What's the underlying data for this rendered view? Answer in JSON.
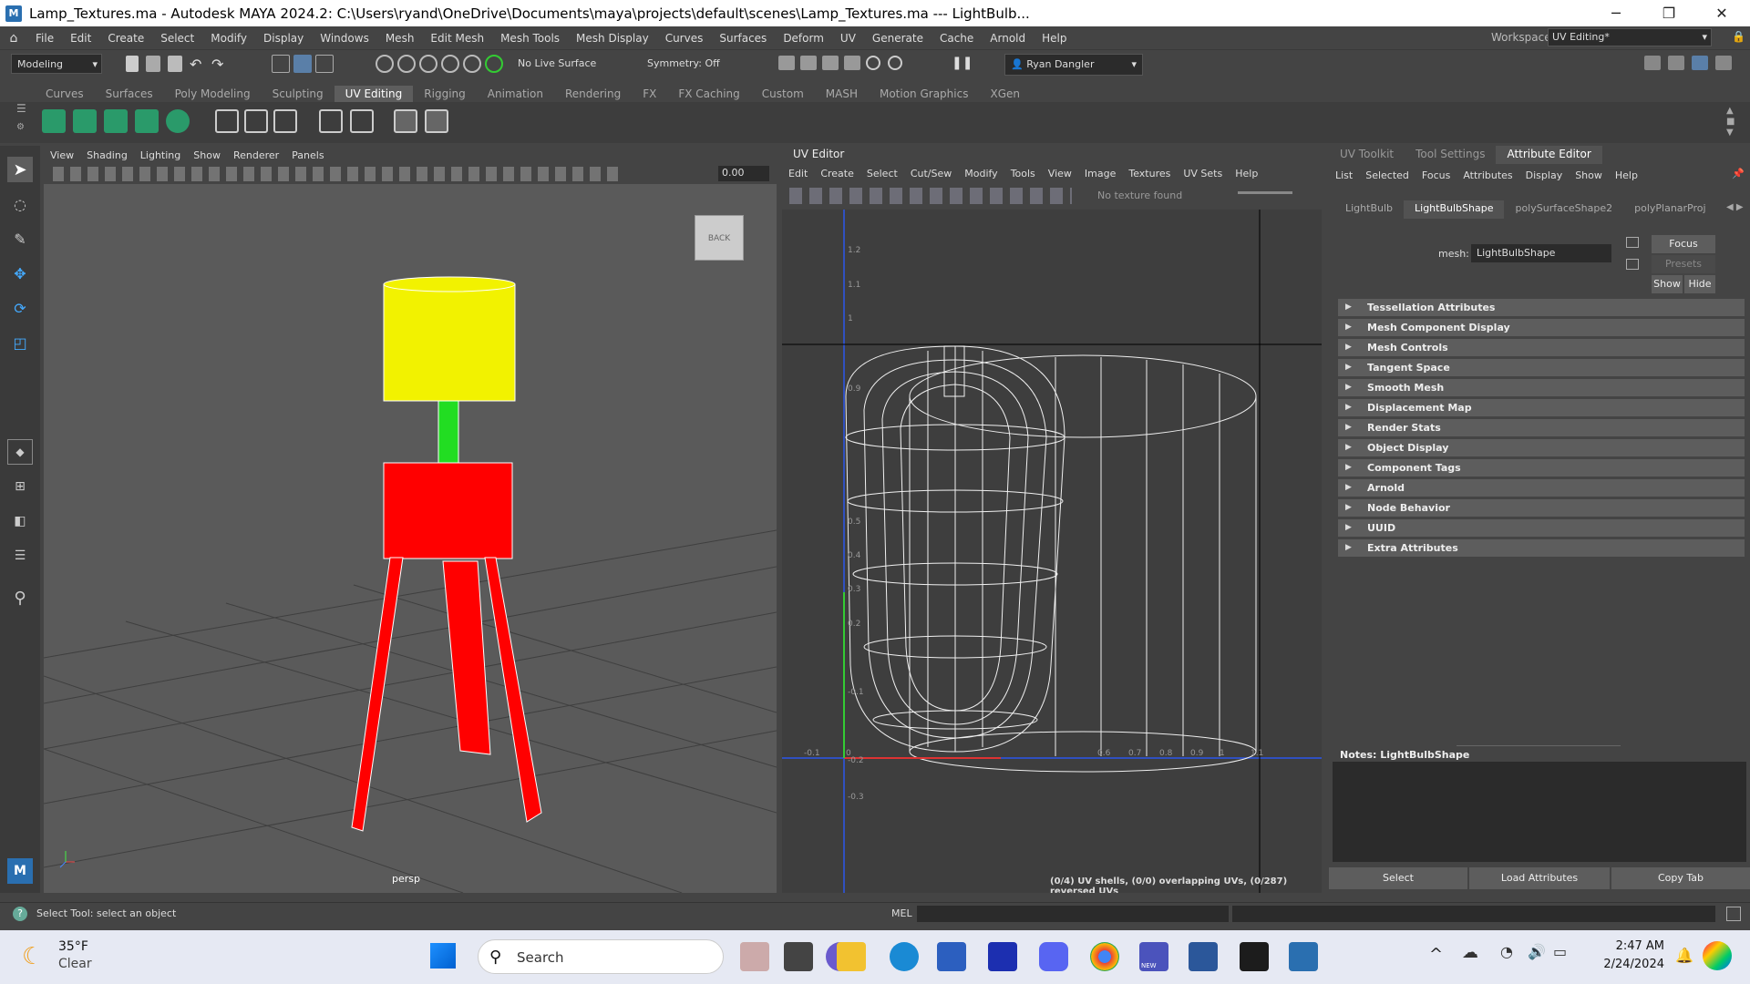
{
  "window": {
    "title": "Lamp_Textures.ma - Autodesk MAYA 2024.2: C:\\Users\\ryand\\OneDrive\\Documents\\maya\\projects\\default\\scenes\\Lamp_Textures.ma   ---   LightBulb...",
    "minimize": "─",
    "restore": "❐",
    "close": "✕"
  },
  "menu": {
    "items": [
      "File",
      "Edit",
      "Create",
      "Select",
      "Modify",
      "Display",
      "Windows",
      "Mesh",
      "Edit Mesh",
      "Mesh Tools",
      "Mesh Display",
      "Curves",
      "Surfaces",
      "Deform",
      "UV",
      "Generate",
      "Cache",
      "Arnold",
      "Help"
    ],
    "workspace_label": "Workspace:",
    "workspace_value": "UV Editing*"
  },
  "statusline": {
    "mode": "Modeling",
    "live_surface": "No Live Surface",
    "symmetry": "Symmetry: Off",
    "user": "Ryan Dangler"
  },
  "shelf": {
    "tabs": [
      "Curves",
      "Surfaces",
      "Poly Modeling",
      "Sculpting",
      "UV Editing",
      "Rigging",
      "Animation",
      "Rendering",
      "FX",
      "FX Caching",
      "Custom",
      "MASH",
      "Motion Graphics",
      "XGen"
    ],
    "active_tab": "UV Editing"
  },
  "viewport": {
    "menu": [
      "View",
      "Shading",
      "Lighting",
      "Show",
      "Renderer",
      "Panels"
    ],
    "field_value": "0.00",
    "viewcube_label": "BACK",
    "camera_label": "persp"
  },
  "uv_editor": {
    "title": "UV Editor",
    "menu": [
      "Edit",
      "Create",
      "Select",
      "Cut/Sew",
      "Modify",
      "Tools",
      "View",
      "Image",
      "Textures",
      "UV Sets",
      "Help"
    ],
    "texture_status": "No texture found",
    "info": "(0/4) UV shells, (0/0) overlapping UVs, (0/287) reversed UVs",
    "v_ticks": [
      "1.2",
      "1.1",
      "1",
      "0.9",
      "0.5",
      "0.4",
      "0.3",
      "0.2",
      "-0.1",
      "-0.2",
      "-0.3"
    ],
    "u_ticks": [
      "-0.1",
      "0",
      "0.6",
      "0.7",
      "0.8",
      "0.9",
      "1",
      "1.1"
    ]
  },
  "attribute_editor": {
    "panel_tabs": [
      "UV Toolkit",
      "Tool Settings",
      "Attribute Editor"
    ],
    "active_panel_tab": "Attribute Editor",
    "menu": [
      "List",
      "Selected",
      "Focus",
      "Attributes",
      "Display",
      "Show",
      "Help"
    ],
    "node_tabs": [
      "LightBulb",
      "LightBulbShape",
      "polySurfaceShape2",
      "polyPlanarProj"
    ],
    "active_node_tab": "LightBulbShape",
    "mesh_label": "mesh:",
    "mesh_value": "LightBulbShape",
    "focus_button": "Focus",
    "presets_button": "Presets",
    "show_button": "Show",
    "hide_button": "Hide",
    "sections": [
      "Tessellation Attributes",
      "Mesh Component Display",
      "Mesh Controls",
      "Tangent Space",
      "Smooth Mesh",
      "Displacement Map",
      "Render Stats",
      "Object Display",
      "Component Tags",
      "Arnold",
      "Node Behavior",
      "UUID",
      "Extra Attributes"
    ],
    "notes_label": "Notes:  LightBulbShape",
    "bottom_buttons": [
      "Select",
      "Load Attributes",
      "Copy Tab"
    ]
  },
  "helpline": {
    "text": "Select Tool: select an object",
    "mel_label": "MEL"
  },
  "taskbar": {
    "weather_temp": "35°F",
    "weather_cond": "Clear",
    "search_placeholder": "Search",
    "time": "2:47 AM",
    "date": "2/24/2024",
    "new_badge": "NEW"
  },
  "colors": {
    "lamp_shade": "#f2f200",
    "lamp_body": "#ff0000",
    "lamp_neck": "#22dd22",
    "maya_blue": "#2a6fb0"
  }
}
